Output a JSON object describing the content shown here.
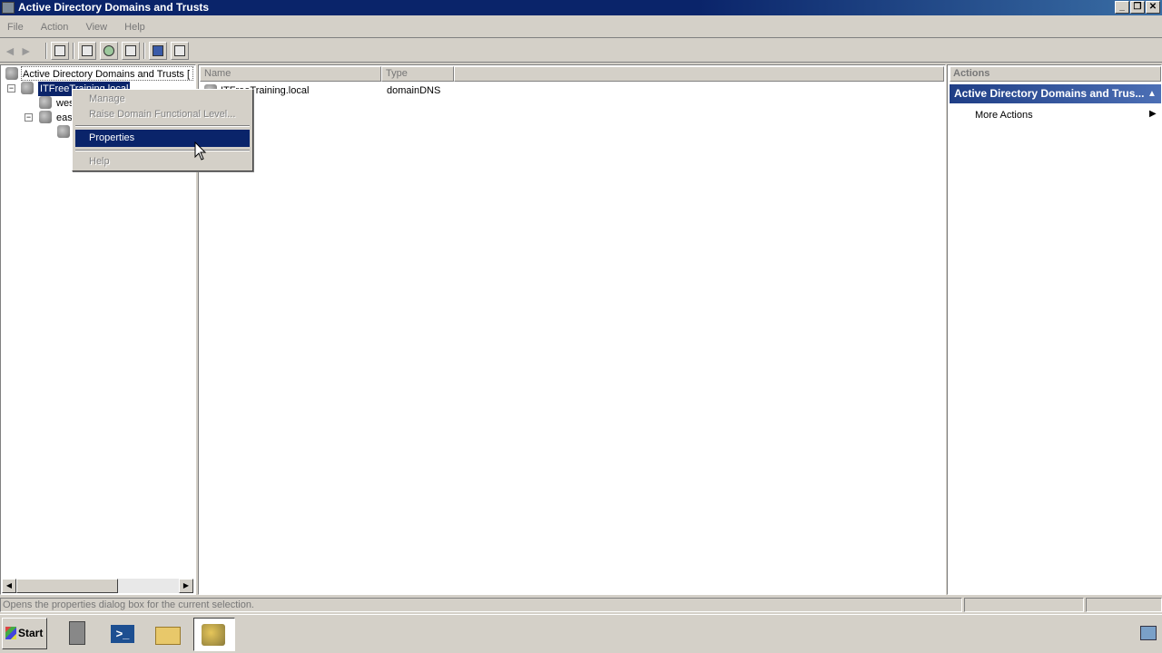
{
  "window": {
    "title": "Active Directory Domains and Trusts",
    "min_glyph": "_",
    "restore_glyph": "❐",
    "close_glyph": "✕"
  },
  "menu": [
    "File",
    "Action",
    "View",
    "Help"
  ],
  "tree": {
    "root_label": "Active Directory Domains and Trusts [ d",
    "domain_label": "ITFreeTraining.local",
    "child1_label": "wes",
    "child2_label": "eas",
    "expander_glyph": "−"
  },
  "list": {
    "columns": [
      "Name",
      "Type"
    ],
    "rows": [
      {
        "name": "ITFreeTraining.local",
        "type": "domainDNS"
      }
    ]
  },
  "context_menu": {
    "items": [
      {
        "label": "Manage",
        "state": "disabled"
      },
      {
        "label": "Raise Domain Functional Level...",
        "state": "disabled"
      },
      {
        "label": "Properties",
        "state": "selected"
      },
      {
        "label": "Help",
        "state": "disabled"
      }
    ]
  },
  "actions": {
    "header": "Actions",
    "section_title": "Active Directory Domains and Trus...",
    "collapse_glyph": "▲",
    "more_actions": "More Actions",
    "submenu_glyph": "▶"
  },
  "statusbar": {
    "text": "Opens the properties dialog box for the current selection."
  },
  "taskbar": {
    "start_label": "Start"
  },
  "colors": {
    "titlebar": "#0a246a",
    "selection": "#0a246a",
    "actions_section": "#1f3e86",
    "chrome": "#d4d0c8"
  }
}
